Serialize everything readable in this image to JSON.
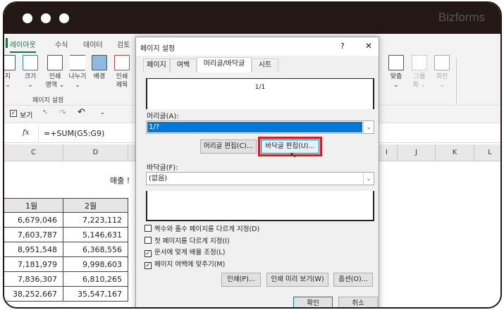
{
  "brand": "Bizforms",
  "ribbon": {
    "tabs": [
      "레이아웃",
      "수식",
      "데이터",
      "검토"
    ],
    "buttons": [
      {
        "label": "지",
        "sub": "⌄"
      },
      {
        "label": "크기",
        "sub": "⌄"
      },
      {
        "label": "인쇄",
        "sub": "영역 ⌄"
      },
      {
        "label": "나누기",
        "sub": "⌄"
      },
      {
        "label": "배경",
        "sub": ""
      },
      {
        "label": "인쇄",
        "sub": "제목"
      }
    ],
    "group_label": "페이지 설정",
    "right_buttons": [
      {
        "label": "맞춤",
        "sub": "⌄"
      },
      {
        "label": "그룹",
        "sub": "화 ⌄"
      },
      {
        "label": "회전",
        "sub": "⌄"
      }
    ]
  },
  "qat": {
    "view_label": "보기"
  },
  "formula_bar": {
    "fx": "fx",
    "formula": "=+SUM(G5:G9)"
  },
  "columns": [
    "C",
    "D",
    "I",
    "J",
    "K",
    "L"
  ],
  "sheet": {
    "title_partial": "매출 !",
    "headers": [
      "1월",
      "2월"
    ],
    "rows": [
      [
        "6,679,046",
        "7,223,112"
      ],
      [
        "7,603,787",
        "5,146,631"
      ],
      [
        "8,951,548",
        "6,368,556"
      ],
      [
        "7,181,979",
        "9,998,603"
      ],
      [
        "7,836,307",
        "6,810,265"
      ],
      [
        "38,252,667",
        "35,547,167"
      ]
    ]
  },
  "dialog": {
    "title": "페이지 설정",
    "help": "?",
    "close": "✕",
    "tabs": [
      "페이지",
      "여백",
      "머리글/바닥글",
      "시트"
    ],
    "header_preview": "1/1",
    "header_label": "머리글(A):",
    "header_value": "1/?",
    "edit_header": "머리글 편집(C)...",
    "edit_footer": "바닥글 편집(U)...",
    "footer_label": "바닥글(F):",
    "footer_value": "(없음)",
    "checkboxes": [
      {
        "label": "짝수와 홀수 페이지를 다르게 지정(D)",
        "checked": false
      },
      {
        "label": "첫 페이지를 다르게 지정(I)",
        "checked": false
      },
      {
        "label": "문서에 맞게 배율 조정(L)",
        "checked": true
      },
      {
        "label": "페이지 여백에 맞추기(M)",
        "checked": true
      }
    ],
    "print": "인쇄(P)...",
    "print_preview": "인쇄 미리 보기(W)",
    "options": "옵션(O)...",
    "ok": "확인",
    "cancel": "취소",
    "highlight_color": "#e0161d",
    "selection_color": "#0078d7"
  }
}
